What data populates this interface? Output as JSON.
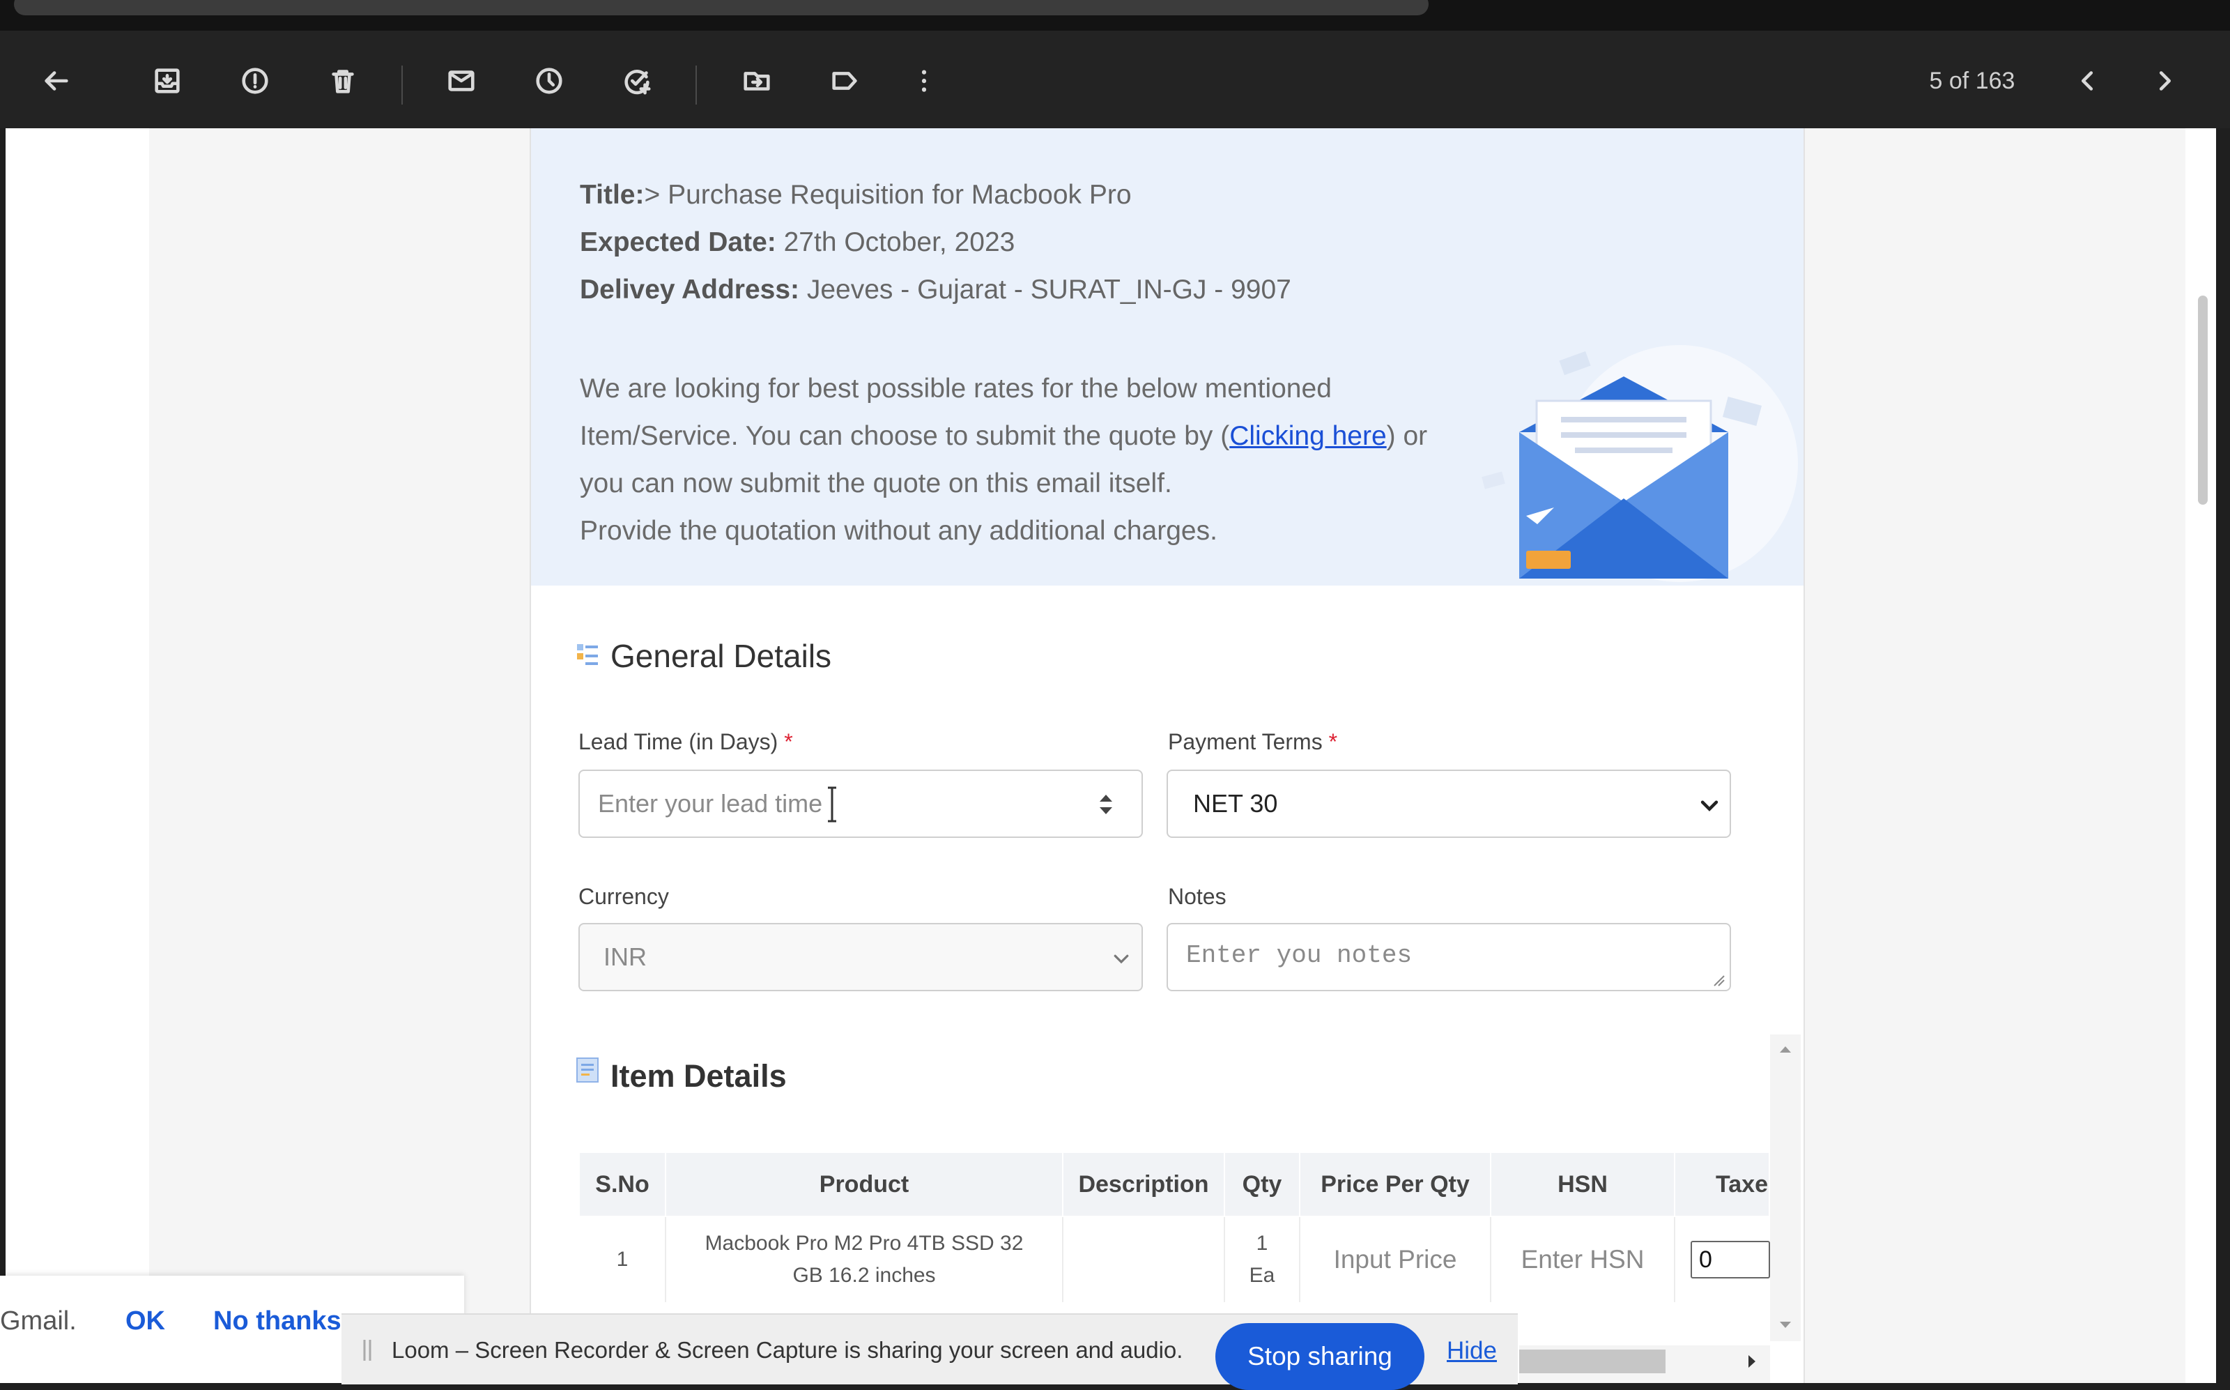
{
  "toolbar": {
    "icons": [
      "back-arrow-icon",
      "archive-icon",
      "report-spam-icon",
      "delete-icon",
      "mark-unread-icon",
      "snooze-icon",
      "add-to-tasks-icon",
      "move-to-icon",
      "label-icon",
      "more-options-icon"
    ],
    "pager": "5 of 163"
  },
  "email": {
    "title_label": "Title:",
    "title_value": "> Purchase Requisition for Macbook Pro",
    "date_label": "Expected Date:",
    "date_value": " 27th October, 2023",
    "address_label": "Delivey Address:",
    "address_value": " Jeeves - Gujarat - SURAT_IN-GJ - 9907",
    "para_line1": "We are looking for best possible rates for the below mentioned",
    "para_line2_pre": "Item/Service. You can choose to submit the quote by (",
    "para_link": "Clicking here",
    "para_line2_post": ") or",
    "para_line3": "you can now submit the quote on this email itself.",
    "para_line4": "Provide the quotation without any additional charges."
  },
  "general": {
    "heading": "General Details",
    "lead_time_label": "Lead Time (in Days)",
    "lead_time_placeholder": "Enter your lead time",
    "payment_terms_label": "Payment Terms",
    "payment_terms_value": "NET 30",
    "currency_label": "Currency",
    "currency_value": "INR",
    "notes_label": "Notes",
    "notes_placeholder": "Enter you notes",
    "required_mark": "*"
  },
  "items": {
    "heading": "Item Details",
    "columns": [
      "S.No",
      "Product",
      "Description",
      "Qty",
      "Price Per Qty",
      "HSN",
      "Taxes"
    ],
    "rows": [
      {
        "sno": "1",
        "product": "Macbook Pro M2 Pro 4TB SSD 32 GB 16.2 inches",
        "description": "",
        "qty": "1",
        "unit": "Ea",
        "price_placeholder": "Input Price",
        "hsn_placeholder": "Enter HSN",
        "taxes_value": "0"
      }
    ]
  },
  "gmail_prompt": {
    "text": "Gmail.",
    "ok": "OK",
    "no_thanks": "No thanks"
  },
  "loom": {
    "message": "Loom – Screen Recorder & Screen Capture is sharing your screen and audio.",
    "stop": "Stop sharing",
    "hide": "Hide"
  },
  "colors": {
    "toolbar_bg": "#232323",
    "hero_bg": "#eaf1fb",
    "link": "#1a4fd6",
    "primary_button": "#1a5bd8",
    "required": "#dd2233"
  }
}
